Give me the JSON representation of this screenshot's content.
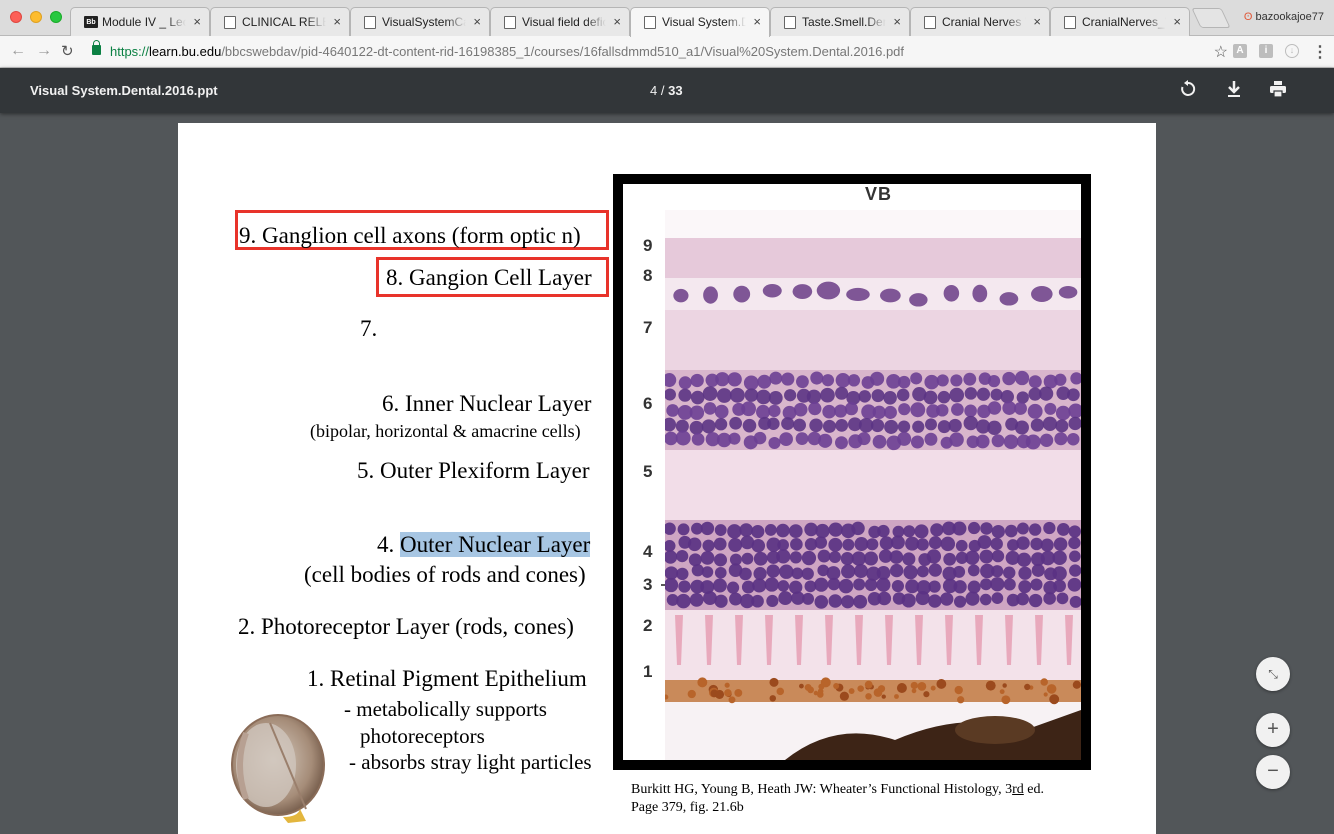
{
  "browser": {
    "tabs": [
      {
        "title": "Module IV _ Lecture",
        "favicon": "blackboard-icon",
        "active": false
      },
      {
        "title": "CLINICAL RELEVANCE",
        "favicon": "document-icon",
        "active": false
      },
      {
        "title": "VisualSystemCase",
        "favicon": "document-icon",
        "active": false
      },
      {
        "title": "Visual field deficits",
        "favicon": "document-icon",
        "active": false
      },
      {
        "title": "Visual System.Dental",
        "favicon": "document-icon",
        "active": true
      },
      {
        "title": "Taste.Smell.Dental",
        "favicon": "document-icon",
        "active": false
      },
      {
        "title": "Cranial Nerves V",
        "favicon": "document-icon",
        "active": false
      },
      {
        "title": "CranialNerves_VII",
        "favicon": "document-icon",
        "active": false
      }
    ],
    "tab_close_glyph": "×",
    "profile_name": "bazookajoe77",
    "url_scheme": "https://",
    "url_host": "learn.bu.edu",
    "url_path": "/bbcswebdav/pid-4640122-dt-content-rid-16198385_1/courses/16fallsdmmd510_a1/Visual%20System.Dental.2016.pdf"
  },
  "pdf_viewer": {
    "title": "Visual System.Dental.2016.ppt",
    "current_page": "4",
    "page_separator": "/",
    "total_pages": "33"
  },
  "slide": {
    "labels": {
      "l9": "9. Ganglion cell axons (form optic n)",
      "l8": "8. Gangion Cell Layer",
      "l7": "7.",
      "l6": "6. Inner Nuclear Layer",
      "l6_sub": "(bipolar, horizontal & amacrine cells)",
      "l5": "5. Outer Plexiform Layer",
      "l4_num": "4.",
      "l4_name": "Outer Nuclear Layer",
      "l4_sub": "(cell bodies of rods and cones)",
      "l2": "2. Photoreceptor Layer (rods, cones)",
      "l1": "1. Retinal Pigment Epithelium",
      "l1_sub1": "- metabolically supports",
      "l1_sub2": "photoreceptors",
      "l1_sub3": "- absorbs stray light particles"
    },
    "micrograph": {
      "corner_label": "VB",
      "layer_numbers": [
        "9",
        "8",
        "7",
        "6",
        "5",
        "4",
        "3",
        "2",
        "1"
      ]
    },
    "caption_line1_a": "Burkitt HG, Young B, Heath JW: Wheater",
    "caption_line1_b": "’",
    "caption_line1_c": "s Functional Histology, 3",
    "caption_line1_d": "rd",
    "caption_line1_e": " ed.",
    "caption_line2": "Page 379, fig. 21.6b"
  },
  "zoom": {
    "in": "+",
    "out": "−"
  },
  "colors": {
    "highlight_box": "#e8332a",
    "selection": "#a7c6e3",
    "pdf_toolbar": "#323639",
    "viewer_bg": "#525659"
  }
}
